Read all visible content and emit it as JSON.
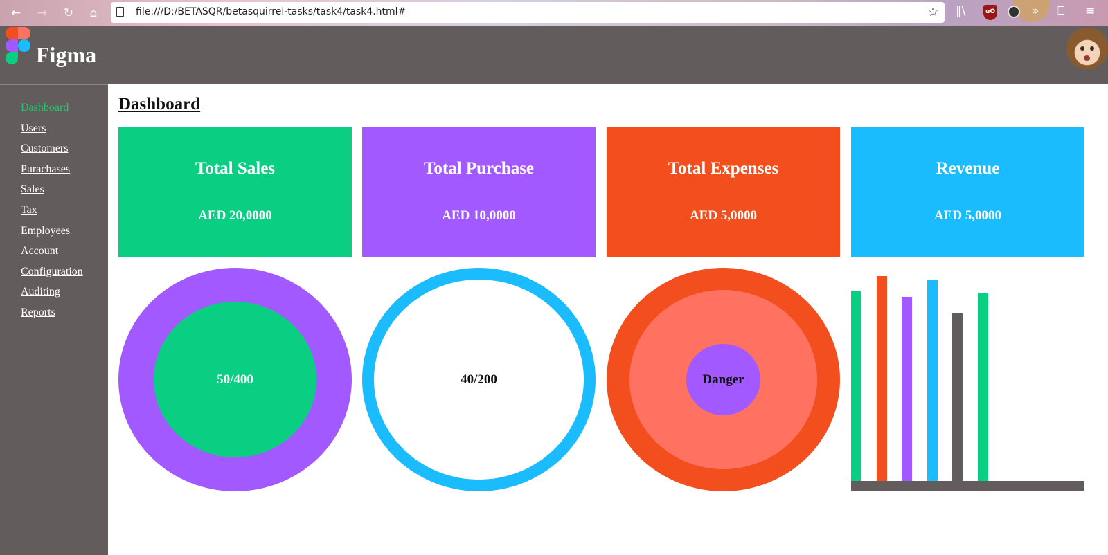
{
  "browser": {
    "url": "file:///D:/BETASQR/betasquirrel-tasks/task4/task4.html#",
    "icons": {
      "back": "arrow-left-icon",
      "forward": "arrow-right-icon",
      "reload": "reload-icon",
      "home": "home-icon",
      "page": "page-icon",
      "bookmark": "star-icon",
      "library": "library-icon",
      "extension_ublock": "ublock-icon",
      "extension_other": "extension-icon",
      "overflow": "chevron-double-right-icon",
      "sync": "sync-icon",
      "menu": "hamburger-menu-icon"
    }
  },
  "header": {
    "logo_text": "Figma",
    "logo_colors": [
      "#f24e1e",
      "#ff7262",
      "#a259ff",
      "#1abcfe",
      "#0acf83"
    ],
    "bg_color": "#635c5c"
  },
  "sidebar": {
    "items": [
      {
        "label": "Dashboard",
        "active": true
      },
      {
        "label": "Users"
      },
      {
        "label": "Customers"
      },
      {
        "label": "Purachases"
      },
      {
        "label": "Sales"
      },
      {
        "label": "Tax"
      },
      {
        "label": "Employees"
      },
      {
        "label": "Account"
      },
      {
        "label": "Configuration"
      },
      {
        "label": "Auditing"
      },
      {
        "label": "Reports"
      }
    ],
    "active_color": "#20c96a"
  },
  "main": {
    "title": "Dashboard",
    "cards": [
      {
        "title": "Total Sales",
        "value": "AED 20,0000",
        "color": "#0acf83"
      },
      {
        "title": "Total Purchase",
        "value": "AED 10,0000",
        "color": "#a259ff"
      },
      {
        "title": "Total Expenses",
        "value": "AED 5,0000",
        "color": "#f24e1e"
      },
      {
        "title": "Revenue",
        "value": "AED 5,0000",
        "color": "#1abcfe"
      }
    ],
    "widgets": {
      "ring1": {
        "label": "50/400",
        "outer_color": "#a259ff",
        "inner_color": "#0acf83"
      },
      "ring2": {
        "label": "40/200",
        "ring_color": "#1abcfe"
      },
      "ring3": {
        "label": "Danger",
        "outer_color": "#f24e1e",
        "middle_color": "#ff7262",
        "inner_color": "#a259ff"
      }
    }
  },
  "chart_data": {
    "type": "bar",
    "values": [
      92,
      99,
      89,
      97,
      81,
      91
    ],
    "colors": [
      "#0acf83",
      "#f24e1e",
      "#a259ff",
      "#1abcfe",
      "#635c5c",
      "#0acf83"
    ],
    "ylim": [
      0,
      100
    ],
    "baseline_color": "#635c5c"
  }
}
